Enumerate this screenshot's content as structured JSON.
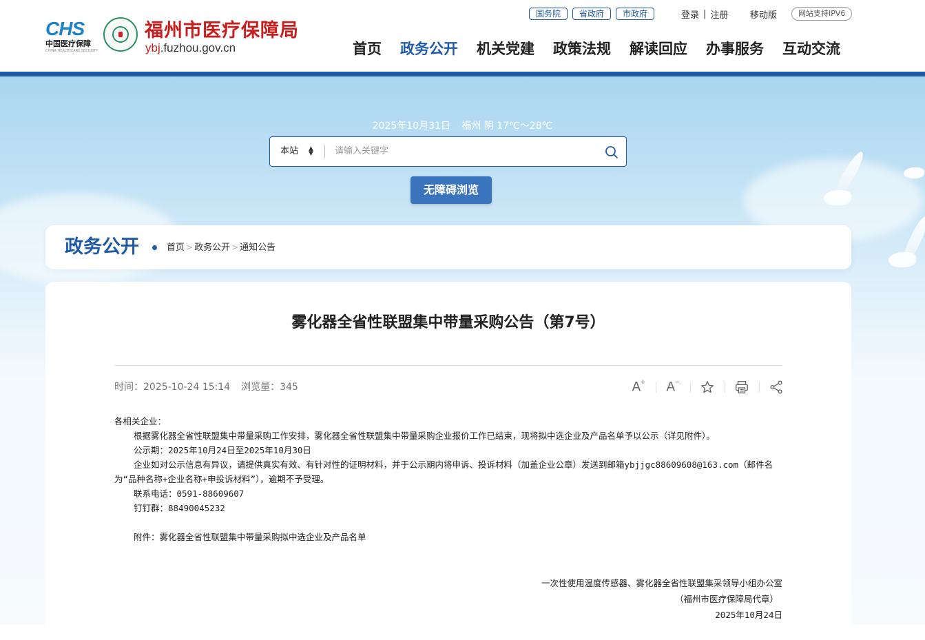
{
  "header": {
    "chs_mark": "CHS",
    "chs_cn": "中国医疗保障",
    "chs_en": "CHINA HEALTHCARE SECURITY",
    "site_name": "福州市医疗保障局",
    "site_domain_prefix": "ybj",
    "site_domain_rest": ".fuzhou.gov.cn",
    "gov_links": [
      "国务院",
      "省政府",
      "市政府"
    ],
    "login": "登录",
    "register": "注册",
    "divider": "|",
    "mobile": "移动版",
    "ipv6": "网站支持IPV6",
    "nav": [
      {
        "label": "首页",
        "active": false
      },
      {
        "label": "政务公开",
        "active": true
      },
      {
        "label": "机关党建",
        "active": false
      },
      {
        "label": "政策法规",
        "active": false
      },
      {
        "label": "解读回应",
        "active": false
      },
      {
        "label": "办事服务",
        "active": false
      },
      {
        "label": "互动交流",
        "active": false
      }
    ]
  },
  "banner": {
    "date": "2025年10月31日",
    "weather": "福州 阴 17℃～28℃",
    "search_scope": "本站",
    "search_placeholder": "请输入关键字",
    "accessibility_button": "无障碍浏览"
  },
  "breadcrumb": {
    "section_title": "政务公开",
    "sep": ">",
    "items": [
      "首页",
      "政务公开",
      "通知公告"
    ]
  },
  "article": {
    "title": "雾化器全省性联盟集中带量采购公告（第7号）",
    "time_label": "时间：",
    "time_value": "2025-10-24 15:14",
    "views_label": "浏览量：",
    "views_value": "345",
    "greeting": "各相关企业：",
    "para1": "根据雾化器全省性联盟集中带量采购工作安排，雾化器全省性联盟集中带量采购企业报价工作已结束，现将拟中选企业及产品名单予以公示（详见附件）。",
    "publicity_period": "公示期：2025年10月24日至2025年10月30日",
    "para2": "企业如对公示信息有异议，请提供真实有效、有针对性的证明材料，并于公示期内将申诉、投诉材料（加盖企业公章）发送到邮箱ybjjgc88609608@163.com（邮件名为“品种名称+企业名称+申投诉材料”），逾期不予受理。",
    "phone": "联系电话：0591-88609607",
    "dingtalk": "钉钉群：88490045232",
    "attachment": "附件：雾化器全省性联盟集中带量采购拟中选企业及产品名单",
    "signature_org": "一次性使用温度传感器、雾化器全省性联盟集采领导小组办公室",
    "signature_proxy": "（福州市医疗保障局代章）",
    "signature_date": "2025年10月24日"
  },
  "colors": {
    "brand_blue": "#1f5aa6",
    "brand_red": "#c51f1f",
    "button_blue": "#3a74bd"
  },
  "icons": [
    "font-increase-icon",
    "font-decrease-icon",
    "star-icon",
    "print-icon",
    "share-icon",
    "search-icon"
  ]
}
